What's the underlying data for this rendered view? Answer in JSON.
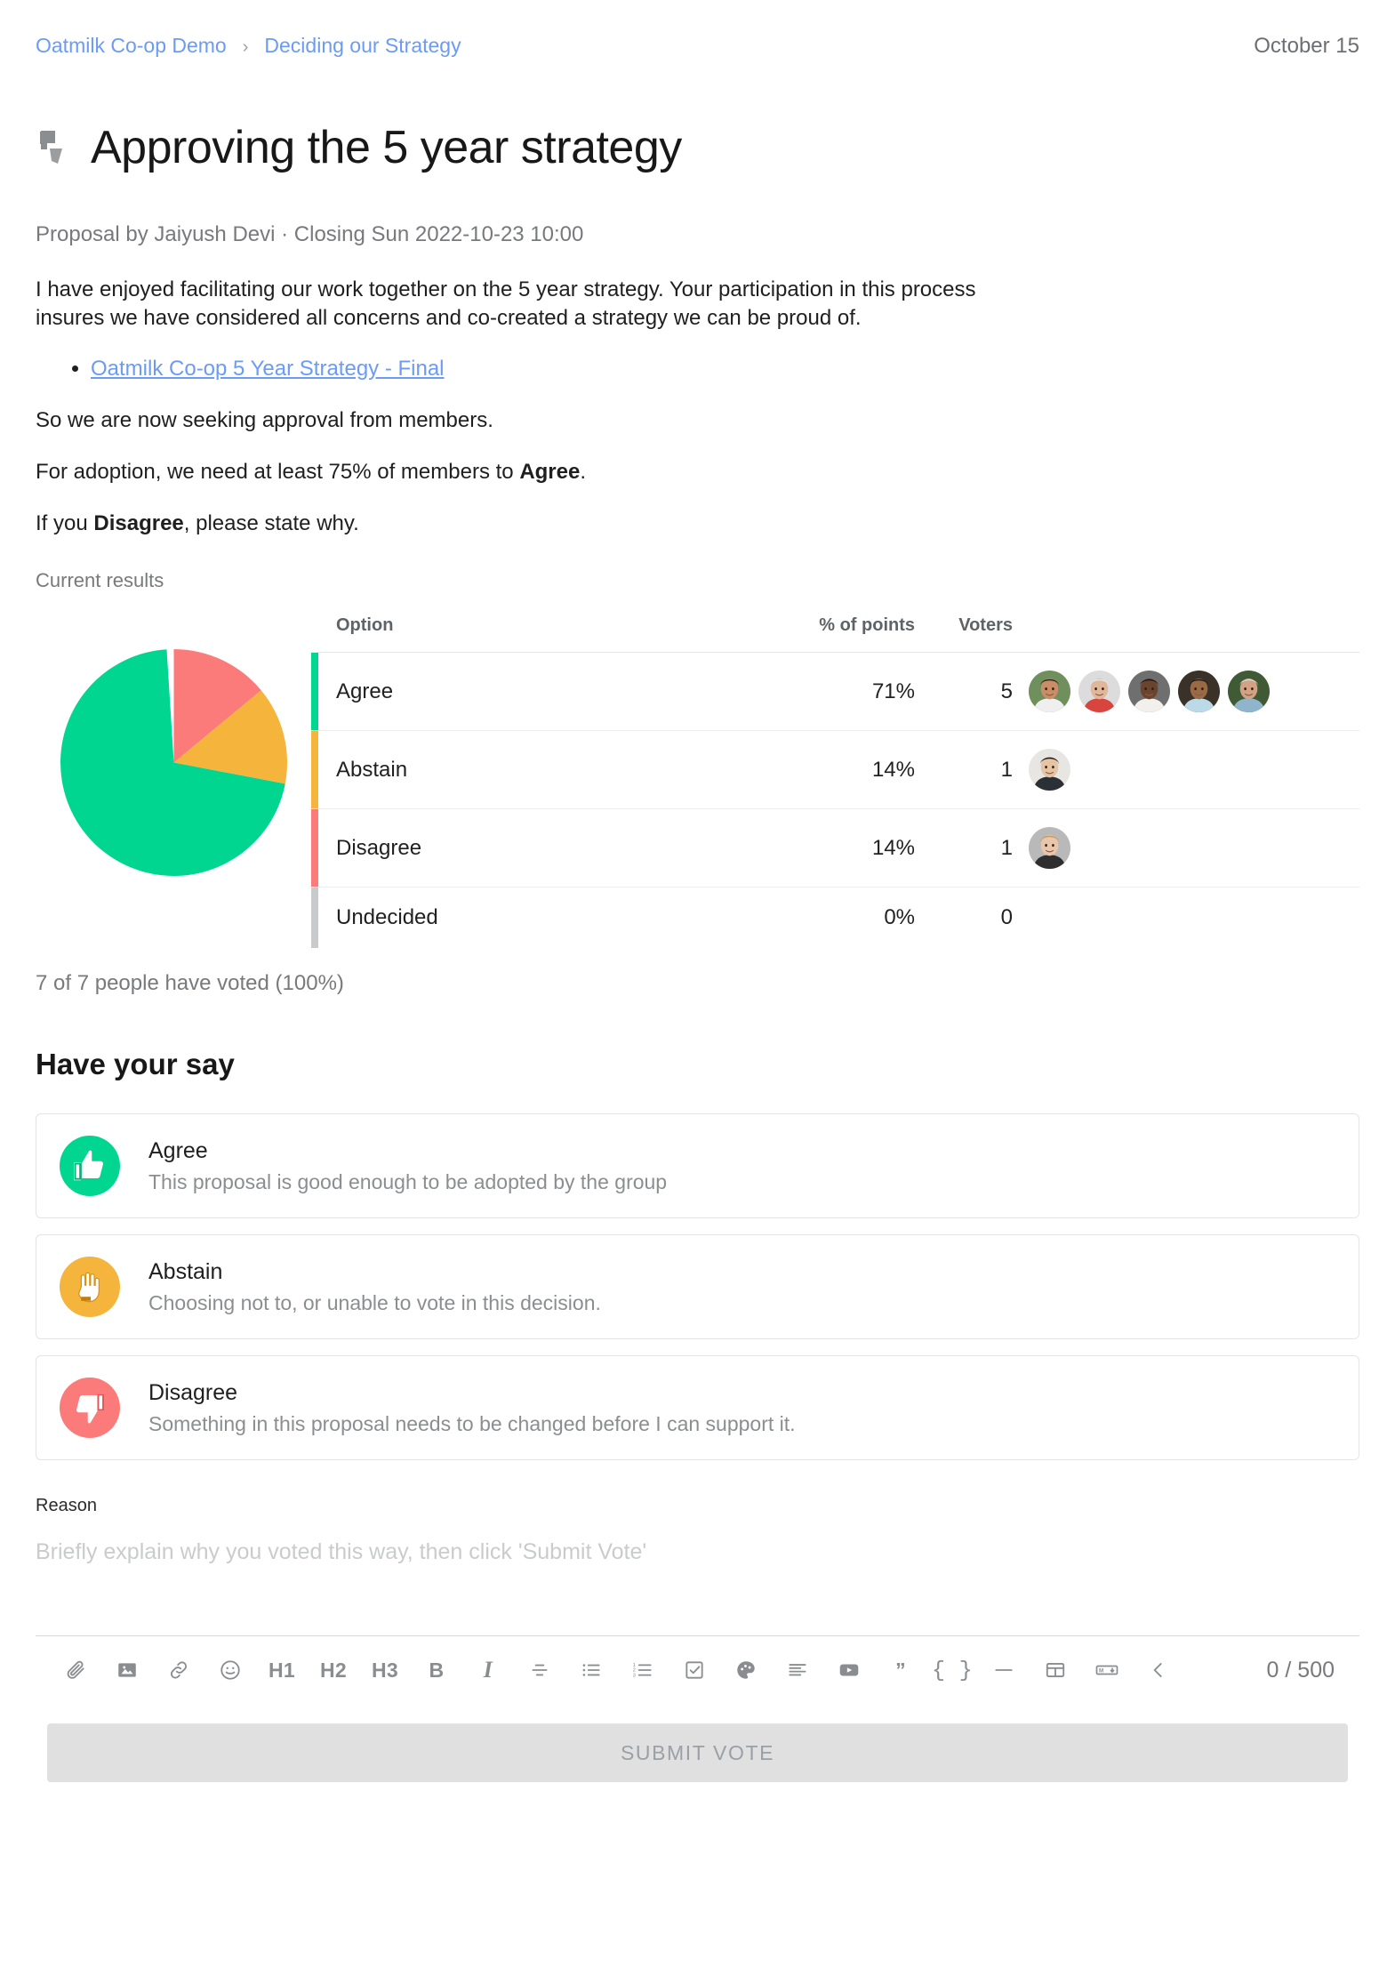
{
  "breadcrumb": {
    "org": "Oatmilk Co-op Demo",
    "separator": "›",
    "group": "Deciding our Strategy"
  },
  "header": {
    "date": "October 15",
    "title": "Approving the 5 year strategy",
    "title_icon": "thumbs-up-down-icon",
    "byline": "Proposal by Jaiyush Devi · Closing Sun 2022-10-23 10:00"
  },
  "body": {
    "paragraph_1": "I have enjoyed facilitating our work together on the 5 year strategy. Your participation in this process insures we have considered all concerns and co-created a strategy we can be proud of.",
    "attachment_link": "Oatmilk Co-op 5 Year Strategy - Final",
    "paragraph_2": "So we are now seeking approval from members.",
    "paragraph_3_pre": "For adoption, we need at least 75% of members to ",
    "paragraph_3_bold": "Agree",
    "paragraph_3_post": ".",
    "paragraph_4_pre": "If you ",
    "paragraph_4_bold": "Disagree",
    "paragraph_4_post": ", please state why."
  },
  "results": {
    "label": "Current results",
    "columns": {
      "option": "Option",
      "percent": "% of points",
      "voters": "Voters",
      "avatars": ""
    },
    "rows": [
      {
        "option": "Agree",
        "percent": "71%",
        "voters": "5",
        "color": "#00d68f",
        "avatar_count": 5
      },
      {
        "option": "Abstain",
        "percent": "14%",
        "voters": "1",
        "color": "#f5b43c",
        "avatar_count": 1
      },
      {
        "option": "Disagree",
        "percent": "14%",
        "voters": "1",
        "color": "#fb7b7b",
        "avatar_count": 1
      },
      {
        "option": "Undecided",
        "percent": "0%",
        "voters": "0",
        "color": "#c9cacb",
        "avatar_count": 0
      }
    ],
    "turnout": "7 of 7 people have voted (100%)"
  },
  "chart_data": {
    "type": "pie",
    "title": "Current results",
    "categories": [
      "Agree",
      "Abstain",
      "Disagree",
      "Undecided"
    ],
    "values": [
      71,
      14,
      14,
      0
    ],
    "voters": [
      5,
      1,
      1,
      0
    ],
    "colors": [
      "#00d68f",
      "#f5b43c",
      "#fb7b7b",
      "#c9cacb"
    ],
    "unit": "% of points",
    "start_angle_deg": 0,
    "direction": "clockwise",
    "slice_order_from_top_clockwise": [
      "Disagree",
      "Abstain",
      "Agree"
    ],
    "legend": "table",
    "total_voters": 7,
    "turnout_pct": 100
  },
  "have_your_say": {
    "heading": "Have your say",
    "options": [
      {
        "label": "Agree",
        "description": "This proposal is good enough to be adopted by the group",
        "color": "#00d68f",
        "icon": "thumb-up-icon"
      },
      {
        "label": "Abstain",
        "description": "Choosing not to, or unable to vote in this decision.",
        "color": "#f5b43c",
        "icon": "raised-hand-icon"
      },
      {
        "label": "Disagree",
        "description": "Something in this proposal needs to be changed before I can support it.",
        "color": "#fb7b7b",
        "icon": "thumb-down-icon"
      }
    ]
  },
  "reason": {
    "label": "Reason",
    "placeholder": "Briefly explain why you voted this way, then click 'Submit Vote'",
    "value": "",
    "counter": "0 / 500"
  },
  "toolbar": {
    "items": [
      {
        "name": "attach-icon",
        "kind": "svg",
        "glyph": "paperclip"
      },
      {
        "name": "image-icon",
        "kind": "svg",
        "glyph": "image"
      },
      {
        "name": "link-icon",
        "kind": "svg",
        "glyph": "link"
      },
      {
        "name": "emoji-icon",
        "kind": "svg",
        "glyph": "emoji"
      },
      {
        "name": "heading-1-button",
        "kind": "text",
        "glyph": "H1"
      },
      {
        "name": "heading-2-button",
        "kind": "text",
        "glyph": "H2"
      },
      {
        "name": "heading-3-button",
        "kind": "text",
        "glyph": "H3"
      },
      {
        "name": "bold-button",
        "kind": "text",
        "glyph": "B"
      },
      {
        "name": "italic-button",
        "kind": "text",
        "glyph": "I"
      },
      {
        "name": "strikethrough-icon",
        "kind": "svg",
        "glyph": "strikethrough"
      },
      {
        "name": "bullet-list-icon",
        "kind": "svg",
        "glyph": "bullet-list"
      },
      {
        "name": "numbered-list-icon",
        "kind": "svg",
        "glyph": "numbered-list"
      },
      {
        "name": "checklist-icon",
        "kind": "svg",
        "glyph": "checklist"
      },
      {
        "name": "color-palette-icon",
        "kind": "svg",
        "glyph": "palette"
      },
      {
        "name": "align-left-icon",
        "kind": "svg",
        "glyph": "align"
      },
      {
        "name": "video-embed-icon",
        "kind": "svg",
        "glyph": "video"
      },
      {
        "name": "blockquote-icon",
        "kind": "text",
        "glyph": "”"
      },
      {
        "name": "code-block-button",
        "kind": "text",
        "glyph": "{ }"
      },
      {
        "name": "horizontal-rule-icon",
        "kind": "svg",
        "glyph": "hr"
      },
      {
        "name": "table-icon",
        "kind": "svg",
        "glyph": "table"
      },
      {
        "name": "markdown-icon",
        "kind": "svg",
        "glyph": "markdown"
      },
      {
        "name": "collapse-toolbar-icon",
        "kind": "svg",
        "glyph": "chevron-left"
      }
    ]
  },
  "submit": {
    "label": "SUBMIT VOTE",
    "enabled": false
  }
}
